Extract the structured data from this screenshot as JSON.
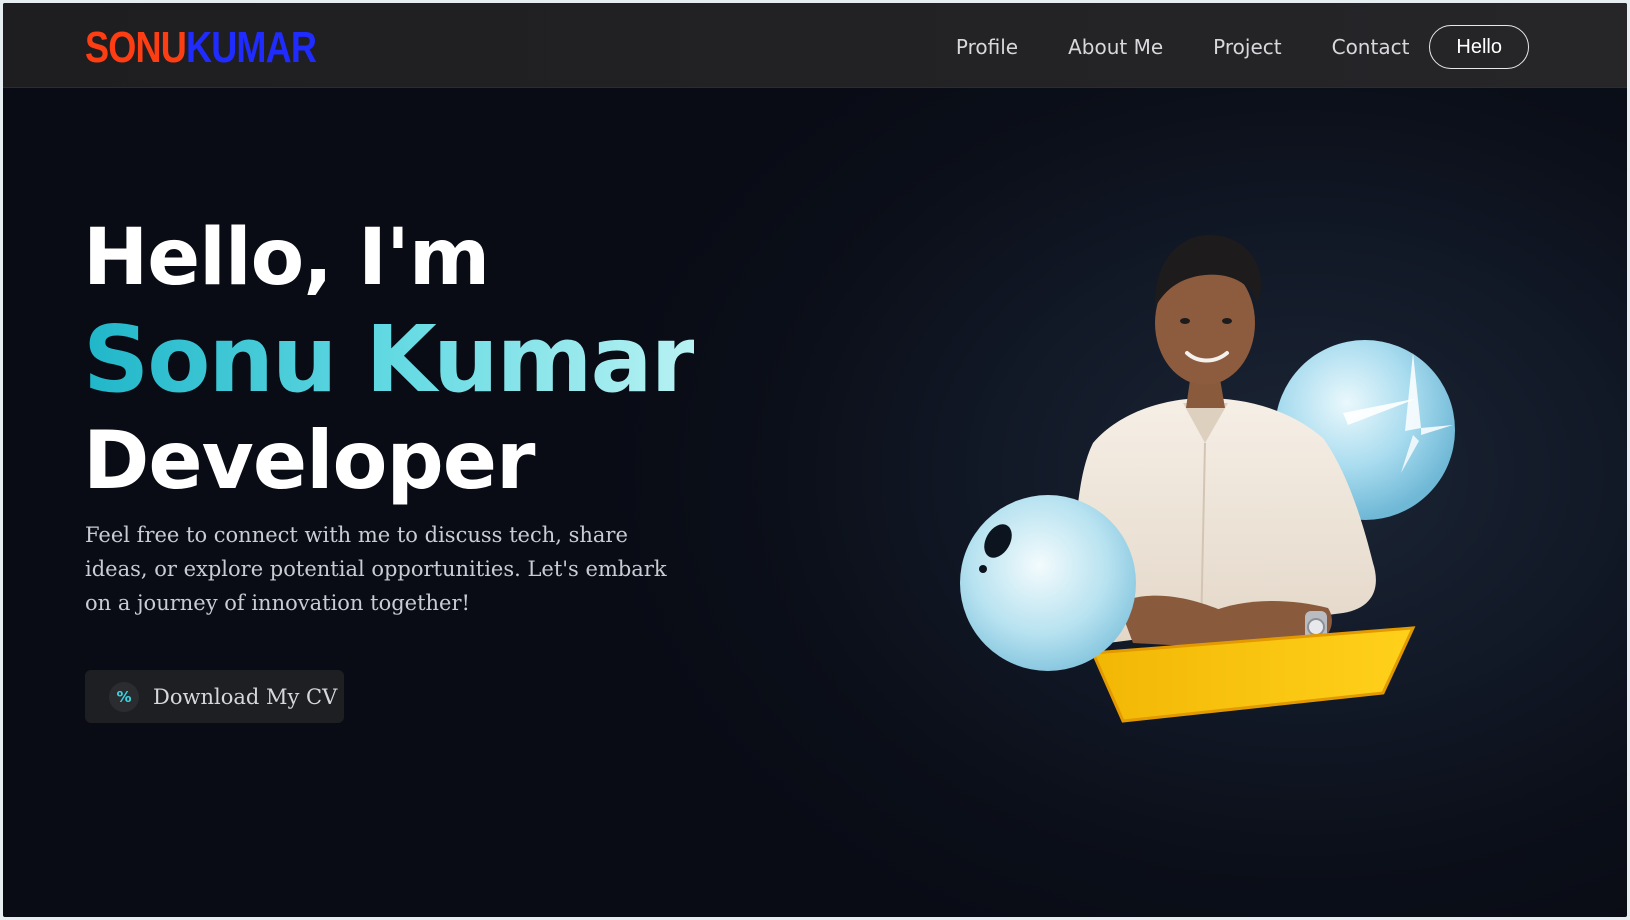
{
  "logo": {
    "first": "SONU",
    "last": "KUMAR"
  },
  "nav": {
    "links": [
      "Profile",
      "About Me",
      "Project",
      "Contact"
    ],
    "cta": "Hello"
  },
  "hero": {
    "greeting": "Hello, I'm",
    "name": "Sonu Kumar",
    "role": "Developer",
    "description": "Feel free to connect with me to discuss tech, share ideas, or explore potential opportunities. Let's embark on a journey of innovation together!",
    "cv_button": "Download My CV",
    "cv_icon": "percent-icon"
  },
  "colors": {
    "logo_first": "#ff3d12",
    "logo_last": "#1f2bff",
    "accent": "#3ad5e0",
    "background": "#0b0f19"
  }
}
